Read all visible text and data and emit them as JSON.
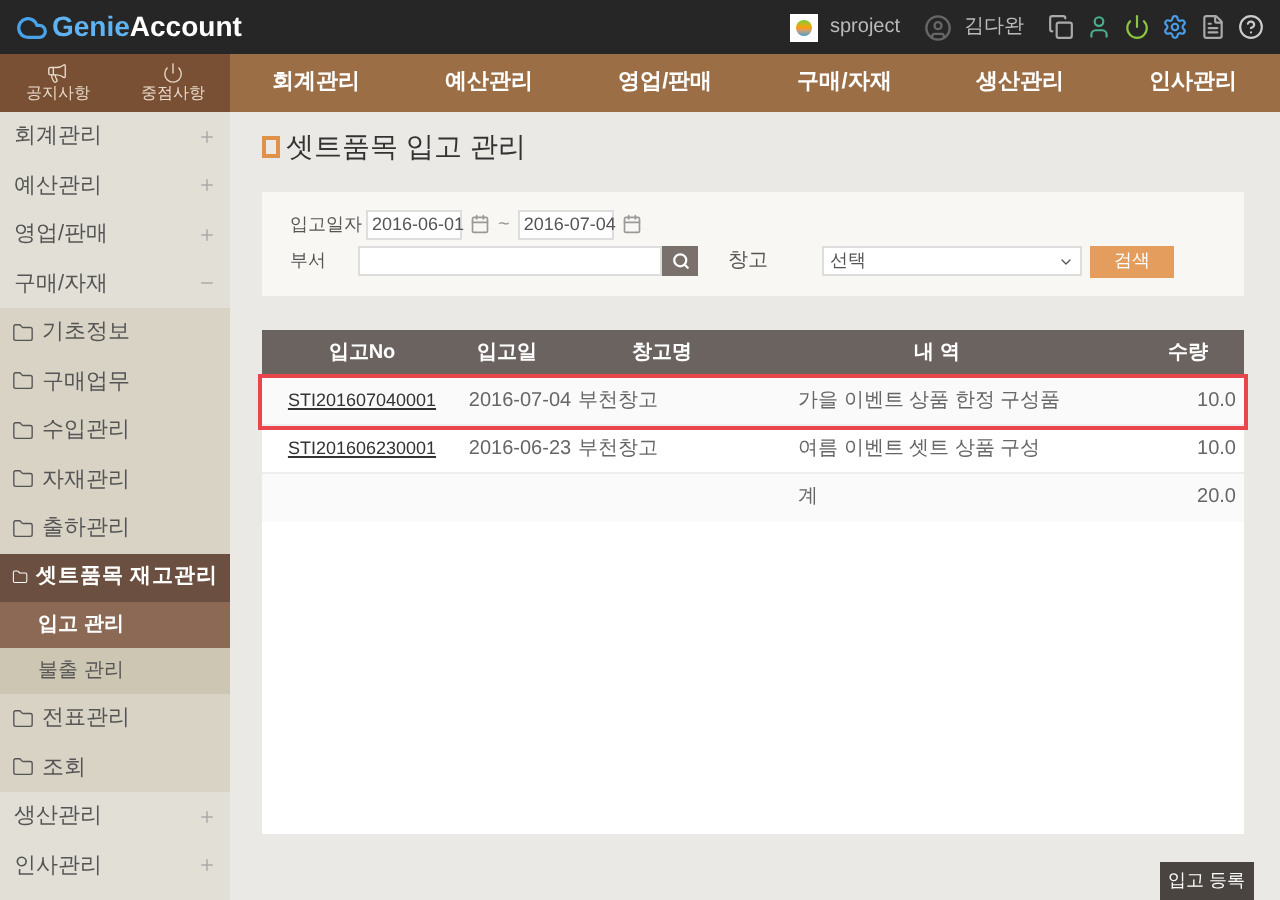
{
  "header": {
    "logo_prefix": "Genie",
    "logo_suffix": "Account",
    "project": "sproject",
    "user": "김다완"
  },
  "quick_links": [
    {
      "label": "공지사항",
      "kind": "megaphone"
    },
    {
      "label": "중점사항",
      "kind": "power"
    }
  ],
  "top_nav": [
    "회계관리",
    "예산관리",
    "영업/판매",
    "구매/자재",
    "생산관리",
    "인사관리"
  ],
  "sidebar": {
    "items": [
      {
        "label": "회계관리",
        "expanded": false
      },
      {
        "label": "예산관리",
        "expanded": false
      },
      {
        "label": "영업/판매",
        "expanded": false
      },
      {
        "label": "구매/자재",
        "expanded": true,
        "children": [
          {
            "label": "기초정보",
            "selected": false
          },
          {
            "label": "구매업무",
            "selected": false
          },
          {
            "label": "수입관리",
            "selected": false
          },
          {
            "label": "자재관리",
            "selected": false
          },
          {
            "label": "출하관리",
            "selected": false
          },
          {
            "label": "셋트품목 재고관리",
            "selected": true,
            "children": [
              {
                "label": "입고 관리",
                "selected": true
              },
              {
                "label": "불출 관리",
                "selected": false
              }
            ]
          },
          {
            "label": "전표관리",
            "selected": false
          },
          {
            "label": "조회",
            "selected": false
          }
        ]
      },
      {
        "label": "생산관리",
        "expanded": false
      },
      {
        "label": "인사관리",
        "expanded": false
      }
    ]
  },
  "page_title": "셋트품목 입고 관리",
  "filters": {
    "date_label": "입고일자",
    "date_from": "2016-06-01",
    "separator": "~",
    "date_to": "2016-07-04",
    "dept_label": "부서",
    "warehouse_label": "창고",
    "warehouse_value": "선택",
    "search_button": "검색"
  },
  "table": {
    "columns": [
      "입고No",
      "입고일",
      "창고명",
      "내 역",
      "수량"
    ],
    "rows": [
      {
        "no": "STI201607040001",
        "date": "2016-07-04",
        "warehouse": "부천창고",
        "detail": "가을 이벤트 상품 한정 구성품",
        "qty": "10.0",
        "highlighted": true
      },
      {
        "no": "STI201606230001",
        "date": "2016-06-23",
        "warehouse": "부천창고",
        "detail": "여름 이벤트 셋트 상품 구성",
        "qty": "10.0",
        "highlighted": false
      }
    ],
    "total": {
      "label": "계",
      "qty": "20.0"
    }
  },
  "register_button": "입고 등록"
}
